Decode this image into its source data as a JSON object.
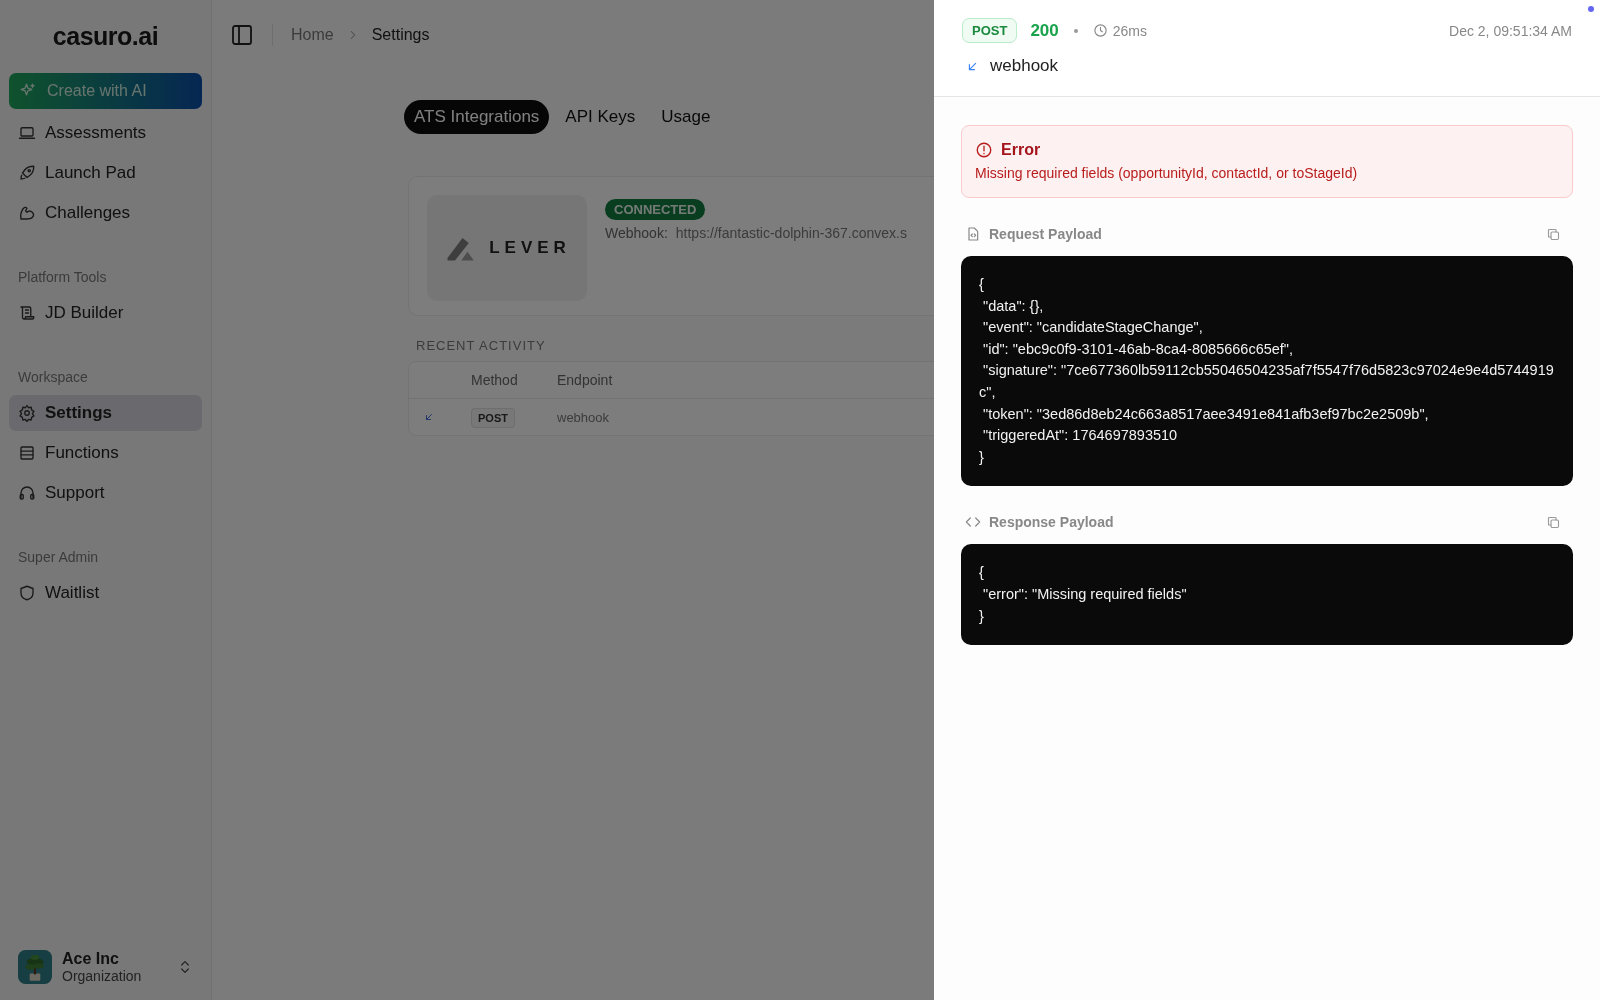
{
  "sidebar": {
    "logo": "casuro.ai",
    "create_button": "Create with AI",
    "sections": [
      {
        "items": [
          {
            "label": "Assessments",
            "selected": false
          },
          {
            "label": "Launch Pad",
            "selected": false
          },
          {
            "label": "Challenges",
            "selected": false
          }
        ]
      },
      {
        "heading": "Platform Tools",
        "items": [
          {
            "label": "JD Builder",
            "selected": false
          }
        ]
      },
      {
        "heading": "Workspace",
        "items": [
          {
            "label": "Settings",
            "selected": true
          },
          {
            "label": "Functions",
            "selected": false
          },
          {
            "label": "Support",
            "selected": false
          }
        ]
      },
      {
        "heading": "Super Admin",
        "items": [
          {
            "label": "Waitlist",
            "selected": false
          }
        ]
      }
    ],
    "organization": {
      "name": "Ace Inc",
      "role": "Organization"
    }
  },
  "breadcrumb": [
    "Home",
    "Settings"
  ],
  "tabs": [
    {
      "label": "ATS Integrations",
      "selected": true
    },
    {
      "label": "API Keys",
      "selected": false
    },
    {
      "label": "Usage",
      "selected": false
    }
  ],
  "integration": {
    "logo": "LEVER",
    "status": "CONNECTED",
    "webhook_label": "Webhook:",
    "webhook_url": "https://fantastic-dolphin-367.convex.s"
  },
  "recent_activity": {
    "title": "RECENT ACTIVITY",
    "columns": [
      "Method",
      "Endpoint"
    ],
    "rows": [
      {
        "method": "POST",
        "endpoint": "webhook"
      }
    ]
  },
  "detail": {
    "method": "POST",
    "status": "200",
    "duration": "26ms",
    "timestamp": "Dec 2, 09:51:34 AM",
    "endpoint": "webhook",
    "error": {
      "title": "Error",
      "message": "Missing required fields (opportunityId, contactId, or toStageId)"
    },
    "request": {
      "title": "Request Payload",
      "lines": [
        "{",
        " \"data\": {},",
        " \"event\": \"candidateStageChange\",",
        " \"id\": \"ebc9c0f9-3101-46ab-8ca4-8085666c65ef\",",
        " \"signature\": \"7ce677360lb59112cb55046504235af7f5547f76d5823c97024e9e4d5744919c\",",
        " \"token\": \"3ed86d8eb24c663a8517aee3491e841afb3ef97bc2e2509b\",",
        " \"triggeredAt\": 1764697893510",
        "}"
      ]
    },
    "response": {
      "title": "Response Payload",
      "lines": [
        "{",
        " \"error\": \"Missing required fields\"",
        "}"
      ]
    }
  }
}
